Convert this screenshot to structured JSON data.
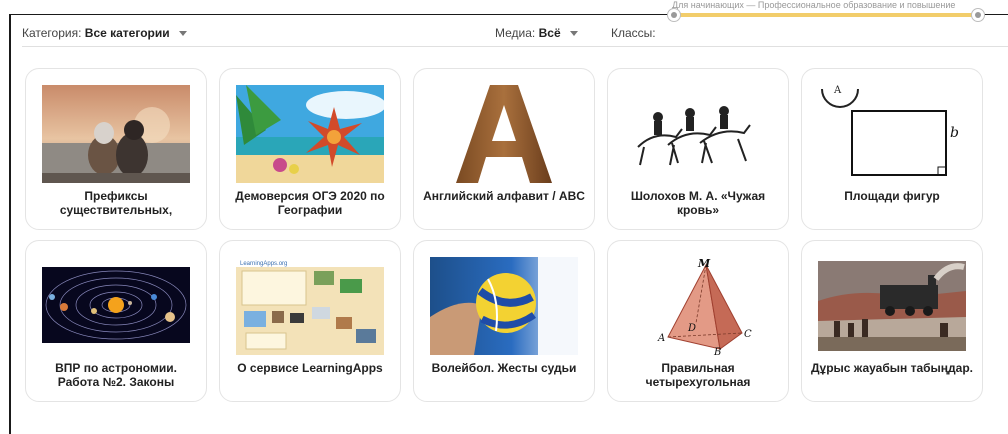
{
  "filters": {
    "category_label": "Категория:",
    "category_value": "Все категории",
    "media_label": "Медиа:",
    "media_value": "Всё",
    "classes_label": "Классы:",
    "classes_range_hint": "Для начинающих — Профессиональное образование и повышение"
  },
  "cards": [
    {
      "title": "Префиксы существительных,",
      "thumbnail": "dog-and-child-at-lake"
    },
    {
      "title": "Демоверсия ОГЭ 2020 по Географии",
      "thumbnail": "tropical-starfish-beach"
    },
    {
      "title": "Английский алфавит / ABC",
      "thumbnail": "wooden-letter-a"
    },
    {
      "title": "Шолохов М. А. «Чужая кровь»",
      "thumbnail": "horse-riders-sketch"
    },
    {
      "title": "Площади фигур",
      "thumbnail": "rectangle-area-diagram"
    },
    {
      "title": "ВПР по астрономии. Работа №2. Законы",
      "thumbnail": "solar-system"
    },
    {
      "title": "О сервисе LearningApps",
      "thumbnail": "learningapps-screenshot"
    },
    {
      "title": "Волейбол. Жесты судьи",
      "thumbnail": "volleyball-ball"
    },
    {
      "title": "Правильная четырехугольная",
      "thumbnail": "pyramid-mabcd"
    },
    {
      "title": "Дұрыс жауабын табыңдар.",
      "thumbnail": "steam-train-painting"
    }
  ],
  "thumb_text": {
    "rect_label_b": "b",
    "rect_label_a": "A",
    "pyr_m": "M",
    "pyr_a": "A",
    "pyr_b": "B",
    "pyr_c": "C",
    "pyr_d": "D",
    "la_header": "LearningApps.org"
  },
  "colors": {
    "slider_track": "#f2cd6b",
    "card_border": "#e4e4e4"
  }
}
